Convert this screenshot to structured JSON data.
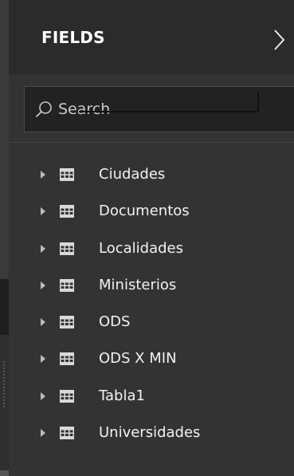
{
  "header": {
    "title": "FIELDS",
    "collapse_icon": "chevron-right-icon"
  },
  "search": {
    "placeholder": "Search",
    "value": "",
    "icon": "search-icon"
  },
  "fields": {
    "items": [
      {
        "label": "Ciudades",
        "icon": "table-icon",
        "expanded": false
      },
      {
        "label": "Documentos",
        "icon": "table-icon",
        "expanded": false
      },
      {
        "label": "Localidades",
        "icon": "table-icon",
        "expanded": false
      },
      {
        "label": "Ministerios",
        "icon": "table-icon",
        "expanded": false
      },
      {
        "label": "ODS",
        "icon": "table-icon",
        "expanded": false
      },
      {
        "label": "ODS X MIN",
        "icon": "table-icon",
        "expanded": false
      },
      {
        "label": "Tabla1",
        "icon": "table-icon",
        "expanded": false
      },
      {
        "label": "Universidades",
        "icon": "table-icon",
        "expanded": false
      }
    ]
  },
  "colors": {
    "panel_bg": "#333333",
    "header_bg": "#2b2b2b",
    "search_bg": "#222222",
    "text": "#f2f2f2",
    "icon": "#bfbfbf"
  }
}
